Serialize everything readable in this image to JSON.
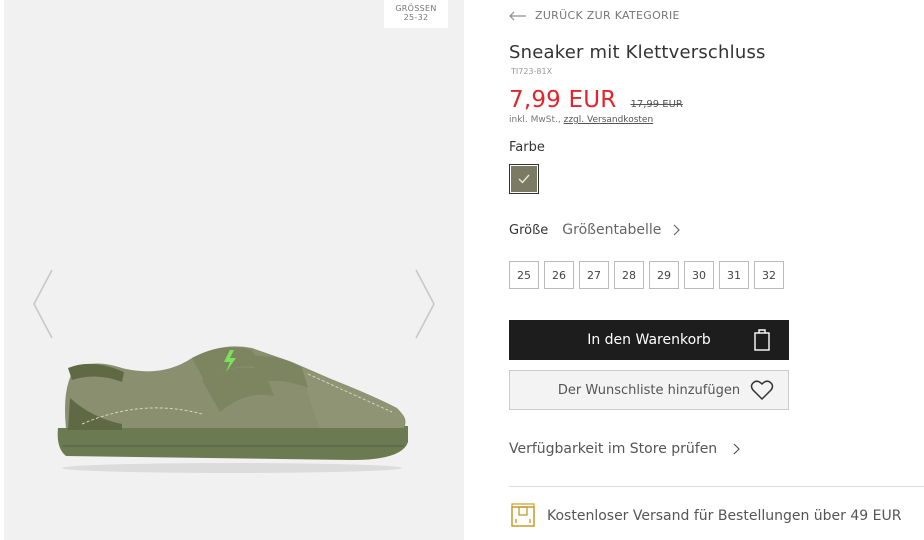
{
  "gallery": {
    "size_badge_line1": "GRÖSSEN",
    "size_badge_line2": "25-32",
    "prev_icon": "chevron-left-icon",
    "next_icon": "chevron-right-icon"
  },
  "product": {
    "back_label": "ZURÜCK ZUR KATEGORIE",
    "title": "Sneaker mit Klettverschluss",
    "sku": "TI723-81X",
    "price_now": "7,99 EUR",
    "price_old": "17,99 EUR",
    "tax_prefix": "inkl. MwSt.,",
    "tax_link": "zzgl. Versandkosten",
    "color_label": "Farbe",
    "color_swatch_hex": "#7b7a62",
    "size_label": "Größe",
    "size_chart_label": "Größentabelle",
    "sizes": [
      "25",
      "26",
      "27",
      "28",
      "29",
      "30",
      "31",
      "32"
    ],
    "cart_button": "In den Warenkorb",
    "wishlist_button": "Der Wunschliste hinzufügen",
    "store_check": "Verfügbarkeit im Store prüfen",
    "shipping_text": "Kostenloser Versand für Bestellungen über 49 EUR"
  },
  "colors": {
    "price_red": "#e0262b",
    "cart_bg": "#1d1d1d",
    "shipping_icon": "#c9a233"
  }
}
